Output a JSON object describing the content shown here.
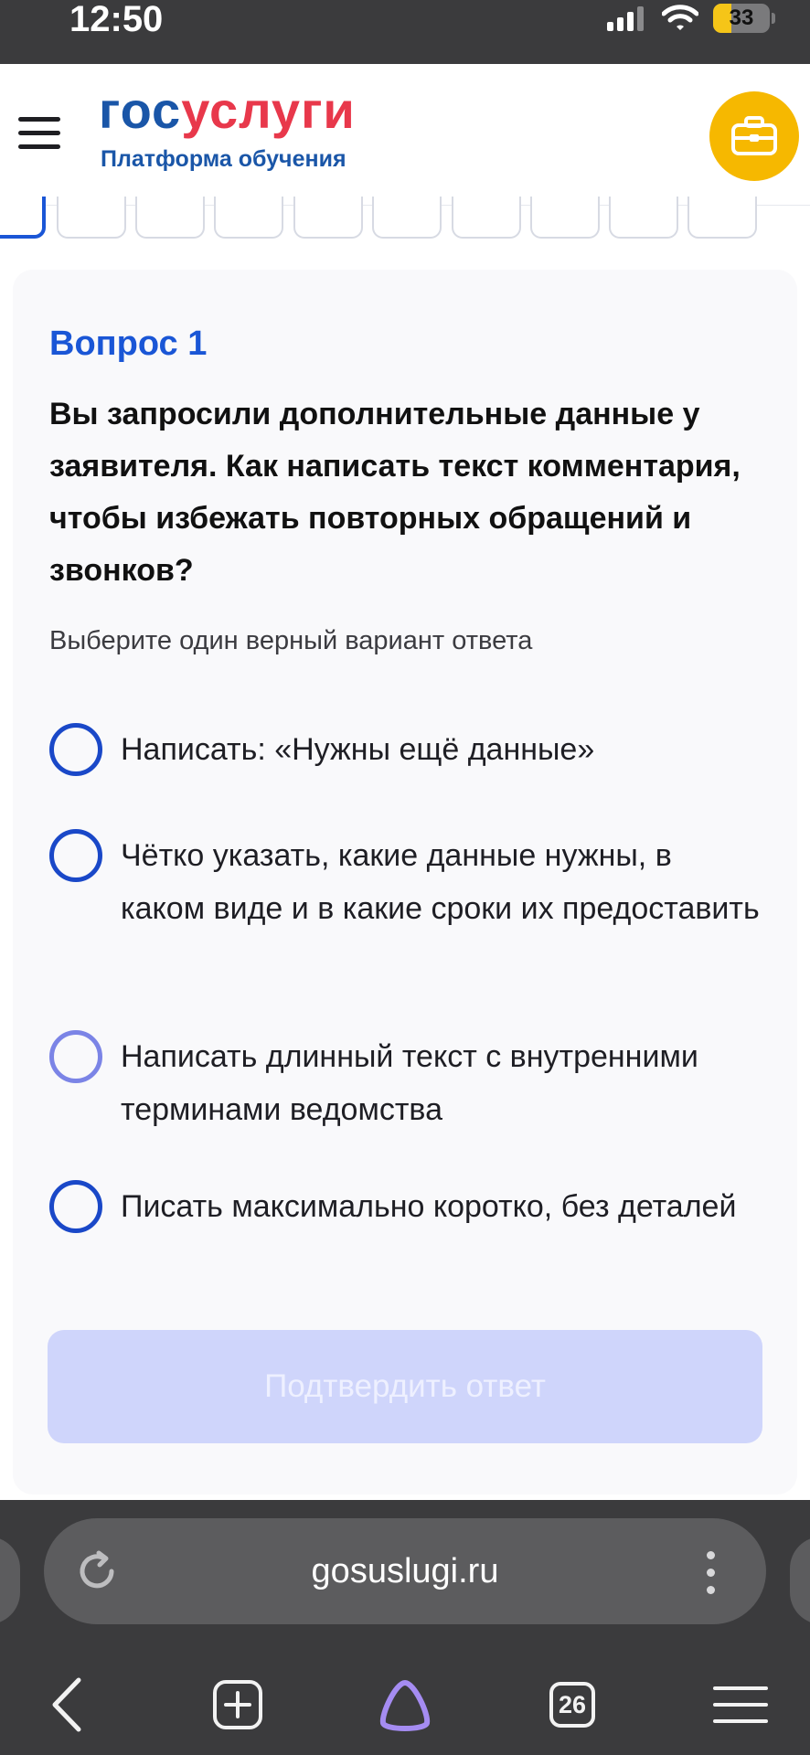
{
  "status_bar": {
    "time": "12:50",
    "battery_level": "33",
    "battery_fraction": 0.33,
    "icons": [
      "cellular-signal-icon",
      "wifi-icon",
      "battery-icon"
    ]
  },
  "header": {
    "logo_part1": "гос",
    "logo_part2": "услуги",
    "logo_subtitle": "Платформа обучения",
    "menu_icon": "hamburger-menu-icon",
    "action_icon": "briefcase-icon"
  },
  "progress": {
    "current_step": 1,
    "visible_steps": 10
  },
  "question": {
    "number_label": "Вопрос 1",
    "text": "Вы запросили дополнительные данные у заявителя. Как написать текст комментария, чтобы избежать повторных обращений и звонков?",
    "hint": "Выберите один верный вариант ответа",
    "options": [
      {
        "label": "Написать: «Нужны ещё данные»",
        "selected": false
      },
      {
        "label": "Чётко указать, какие данные нужны, в каком виде и в какие сроки их предоставить",
        "selected": false
      },
      {
        "label": "Написать длинный текст с внутренними терминами ведомства",
        "selected": false
      },
      {
        "label": "Писать максимально коротко, без деталей",
        "selected": false
      }
    ],
    "confirm_label": "Подтвердить ответ",
    "confirm_enabled": false
  },
  "browser": {
    "url": "gosuslugi.ru",
    "tab_count": "26",
    "icons": [
      "reload-icon",
      "more-vertical-icon",
      "back-arrow-icon",
      "new-tab-icon",
      "alice-assistant-icon",
      "tabs-icon",
      "menu-icon"
    ]
  },
  "colors": {
    "accent_blue": "#1a56d6",
    "logo_blue": "#1a56a8",
    "logo_red": "#e8384b",
    "briefcase_yellow": "#f6b800",
    "disabled_button": "#cfd5fb",
    "chrome_dark": "#3b3b3d",
    "alice_purple": "#a58cf2"
  }
}
